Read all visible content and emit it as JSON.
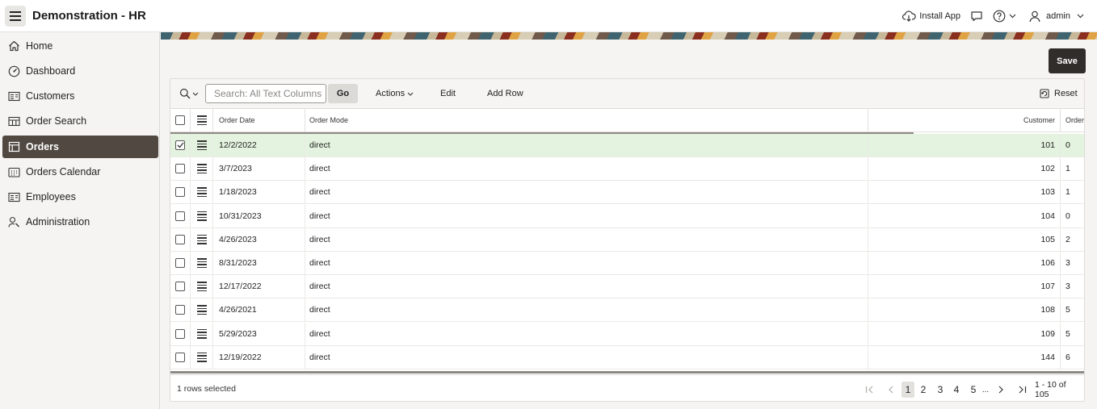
{
  "header": {
    "app_title": "Demonstration - HR",
    "install_app": "Install App",
    "user": "admin"
  },
  "sidebar": {
    "items": [
      {
        "label": "Home",
        "icon": "home-icon"
      },
      {
        "label": "Dashboard",
        "icon": "dashboard-icon"
      },
      {
        "label": "Customers",
        "icon": "customers-icon"
      },
      {
        "label": "Order Search",
        "icon": "order-search-icon"
      },
      {
        "label": "Orders",
        "icon": "orders-icon",
        "active": true
      },
      {
        "label": "Orders Calendar",
        "icon": "calendar-icon"
      },
      {
        "label": "Employees",
        "icon": "employees-icon"
      },
      {
        "label": "Administration",
        "icon": "administration-icon"
      }
    ]
  },
  "page": {
    "save_label": "Save"
  },
  "toolbar": {
    "search_placeholder": "Search: All Text Columns",
    "go_label": "Go",
    "actions_label": "Actions",
    "edit_label": "Edit",
    "add_row_label": "Add Row",
    "reset_label": "Reset"
  },
  "table": {
    "columns": {
      "order_date": "Order Date",
      "order_mode": "Order Mode",
      "customer": "Customer",
      "order": "Order"
    },
    "rows": [
      {
        "date": "12/2/2022",
        "mode": "direct",
        "customer": "101",
        "order": "0",
        "selected": true
      },
      {
        "date": "3/7/2023",
        "mode": "direct",
        "customer": "102",
        "order": "1"
      },
      {
        "date": "1/18/2023",
        "mode": "direct",
        "customer": "103",
        "order": "1"
      },
      {
        "date": "10/31/2023",
        "mode": "direct",
        "customer": "104",
        "order": "0"
      },
      {
        "date": "4/26/2023",
        "mode": "direct",
        "customer": "105",
        "order": "2"
      },
      {
        "date": "8/31/2023",
        "mode": "direct",
        "customer": "106",
        "order": "3"
      },
      {
        "date": "12/17/2022",
        "mode": "direct",
        "customer": "107",
        "order": "3"
      },
      {
        "date": "4/26/2021",
        "mode": "direct",
        "customer": "108",
        "order": "5"
      },
      {
        "date": "5/29/2023",
        "mode": "direct",
        "customer": "109",
        "order": "5"
      },
      {
        "date": "12/19/2022",
        "mode": "direct",
        "customer": "144",
        "order": "6"
      }
    ]
  },
  "footer": {
    "selection_text": "1 rows selected",
    "pages": [
      "1",
      "2",
      "3",
      "4",
      "5"
    ],
    "ellipsis": "...",
    "current_page": "1",
    "range_text": "1 - 10 of 105"
  },
  "colors": {
    "active_nav_bg": "#504841",
    "save_bg": "#312d2a",
    "selected_row_bg": "#e4f3df"
  }
}
